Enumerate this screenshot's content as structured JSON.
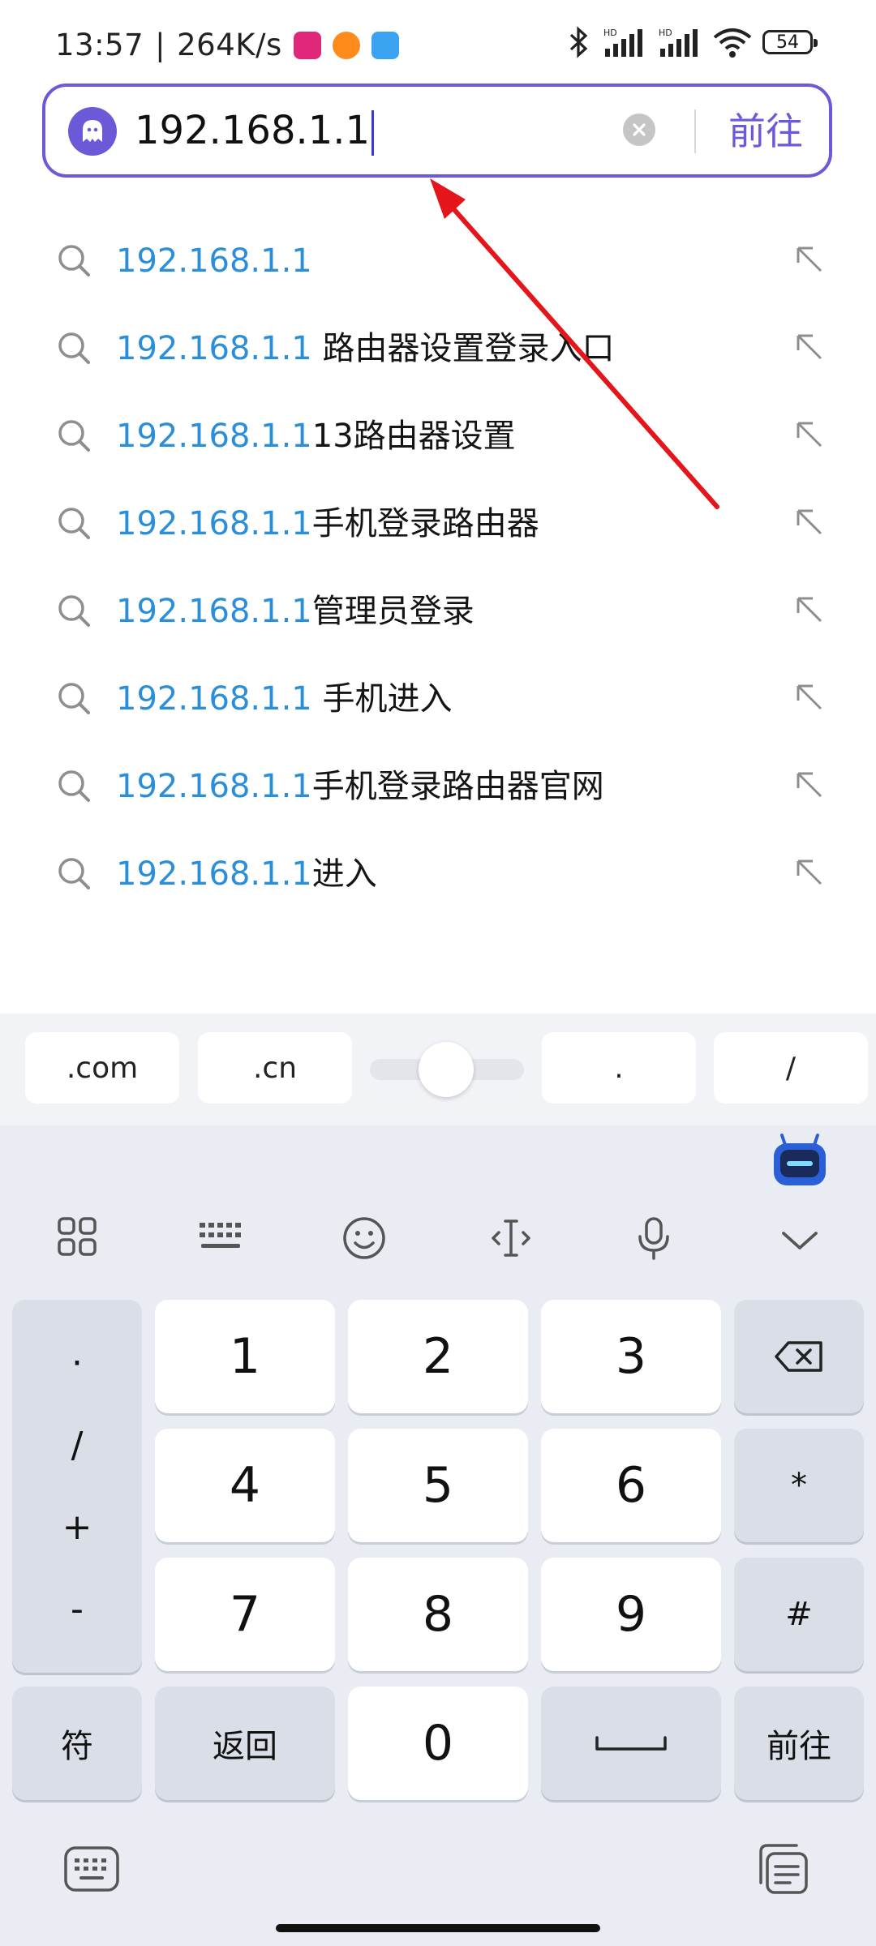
{
  "status_bar": {
    "time": "13:57",
    "speed": "264K/s",
    "battery": "54",
    "icons": [
      "bluetooth-icon",
      "hd-signal-icon",
      "hd-signal-icon",
      "wifi-icon",
      "battery-icon"
    ]
  },
  "search": {
    "value": "192.168.1.1",
    "go_label": "前往"
  },
  "suggestions": [
    {
      "match": "192.168.1.1",
      "rest": ""
    },
    {
      "match": "192.168.1.1",
      "rest": " 路由器设置登录入口"
    },
    {
      "match": "192.168.1.1",
      "rest": "13路由器设置"
    },
    {
      "match": "192.168.1.1",
      "rest": "手机登录路由器"
    },
    {
      "match": "192.168.1.1",
      "rest": "管理员登录"
    },
    {
      "match": "192.168.1.1",
      "rest": " 手机进入"
    },
    {
      "match": "192.168.1.1",
      "rest": "手机登录路由器官网"
    },
    {
      "match": "192.168.1.1",
      "rest": "进入"
    }
  ],
  "quick_keys": [
    ".com",
    ".cn",
    ".",
    "/"
  ],
  "keyboard": {
    "symbols": [
      "·",
      "/",
      "+",
      "-"
    ],
    "digits": [
      "1",
      "2",
      "3",
      "4",
      "5",
      "6",
      "7",
      "8",
      "9",
      "0"
    ],
    "star": "*",
    "hash": "#",
    "fu": "符",
    "back": "返回",
    "go": "前往"
  },
  "colors": {
    "accent": "#6a5ad8",
    "match_blue": "#2a8fd8",
    "annotation_red": "#e5161b"
  }
}
